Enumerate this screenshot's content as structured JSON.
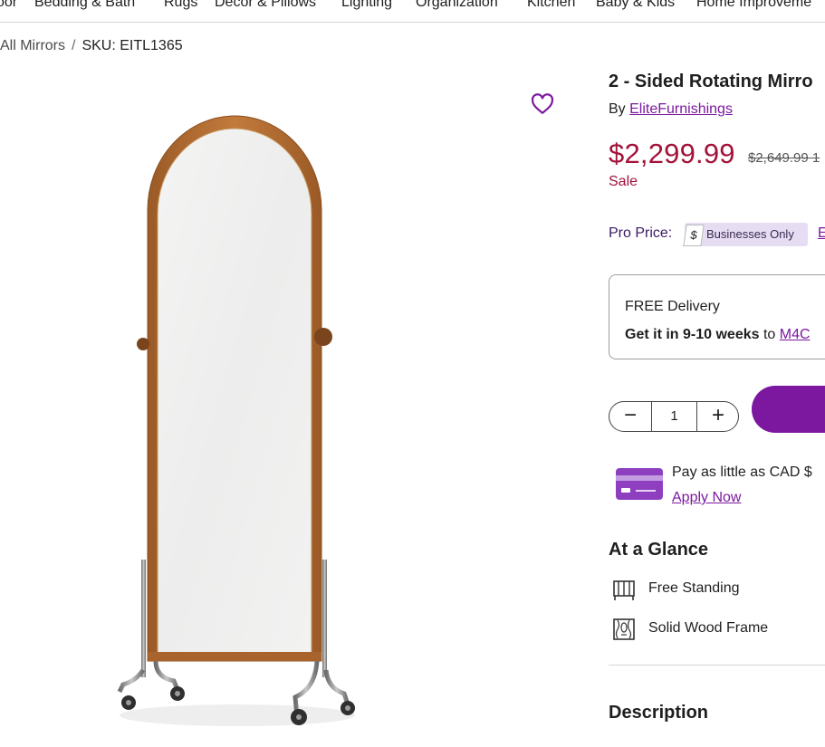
{
  "topnav": {
    "items": [
      "oor",
      "Bedding & Bath",
      "Rugs",
      "Decor & Pillows",
      "Lighting",
      "Organization",
      "Kitchen",
      "Baby & Kids",
      "Home Improveme"
    ]
  },
  "breadcrumb": {
    "parent": "All Mirrors",
    "separator": "/",
    "sku": "SKU: EITL1365"
  },
  "product": {
    "title": "2 - Sided Rotating Mirro",
    "by_prefix": "By",
    "brand": "EliteFurnishings",
    "price": "$2,299.99",
    "old_price": "$2,649.99",
    "old_price_suffix": "1",
    "sale_label": "Sale",
    "pro_price_label": "Pro Price:",
    "pro_tag": "$",
    "pro_badge": "Businesses Only",
    "pro_link": "E"
  },
  "delivery": {
    "headline": "FREE Delivery",
    "eta_bold": "Get it in 9-10 weeks",
    "eta_to": "to",
    "postal_link": "M4C"
  },
  "quantity": {
    "minus": "−",
    "value": "1",
    "plus": "+"
  },
  "financing": {
    "text": "Pay as little as CAD $",
    "apply": "Apply Now"
  },
  "glance": {
    "title": "At a Glance",
    "items": [
      {
        "label": "Free Standing",
        "icon": "free-standing-icon"
      },
      {
        "label": "Solid Wood Frame",
        "icon": "wood-grain-icon"
      }
    ]
  },
  "description": {
    "title": "Description"
  },
  "colors": {
    "accent": "#7b189f",
    "price": "#a3123a",
    "wood": "#b06c32",
    "chrome": "#8c8c8c"
  }
}
